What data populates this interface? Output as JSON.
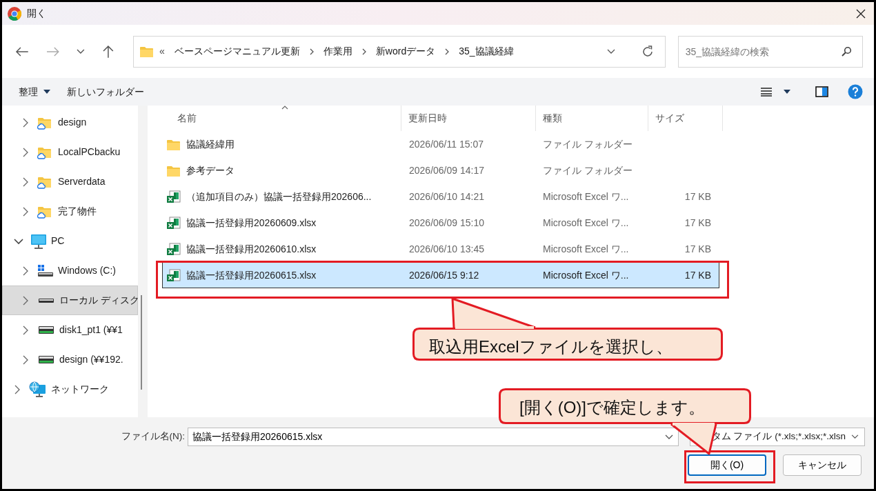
{
  "window": {
    "title": "開く"
  },
  "address": {
    "overflow": "«",
    "segments": [
      "ベースページマニュアル更新",
      "作業用",
      "新wordデータ",
      "35_協議経緯"
    ]
  },
  "search": {
    "placeholder": "35_協議経緯の検索"
  },
  "toolbar": {
    "organize": "整理",
    "new_folder": "新しいフォルダー"
  },
  "sidebar": {
    "items": [
      {
        "kind": "cloud-folder",
        "label": "design",
        "expanded": false,
        "selected": false
      },
      {
        "kind": "cloud-folder",
        "label": "LocalPCbacku",
        "expanded": false,
        "selected": false
      },
      {
        "kind": "cloud-folder",
        "label": "Serverdata",
        "expanded": false,
        "selected": false
      },
      {
        "kind": "cloud-folder",
        "label": "完了物件",
        "expanded": false,
        "selected": false
      },
      {
        "kind": "pc",
        "label": "PC",
        "expanded": true,
        "selected": false,
        "children": [
          {
            "kind": "windows-drive",
            "label": "Windows (C:)",
            "expanded": false,
            "selected": false
          },
          {
            "kind": "drive",
            "label": "ローカル ディスク",
            "expanded": false,
            "selected": true
          },
          {
            "kind": "network-drive",
            "label": "disk1_pt1 (¥¥1",
            "expanded": false,
            "selected": false
          },
          {
            "kind": "network-drive",
            "label": "design (¥¥192.",
            "expanded": false,
            "selected": false
          }
        ]
      },
      {
        "kind": "network",
        "label": "ネットワーク",
        "expanded": false,
        "selected": false
      }
    ]
  },
  "table": {
    "columns": [
      {
        "label": "名前",
        "sorted": true
      },
      {
        "label": "更新日時",
        "sorted": false
      },
      {
        "label": "種類",
        "sorted": false
      },
      {
        "label": "サイズ",
        "sorted": false
      }
    ],
    "rows": [
      {
        "kind": "folder",
        "name": "協議経緯用",
        "date": "2026/06/11 15:07",
        "type": "ファイル フォルダー",
        "selected": false
      },
      {
        "kind": "folder",
        "name": "参考データ",
        "date": "2026/06/09 14:17",
        "type": "ファイル フォルダー",
        "selected": false
      },
      {
        "kind": "excel",
        "name": "（追加項目のみ）協議一括登録用202606...",
        "date": "2026/06/10 14:21",
        "type": "Microsoft Excel ワ...",
        "size": "17 KB",
        "selected": false
      },
      {
        "kind": "excel",
        "name": "協議一括登録用20260609.xlsx",
        "date": "2026/06/09 15:10",
        "type": "Microsoft Excel ワ...",
        "size": "17 KB",
        "selected": false
      },
      {
        "kind": "excel",
        "name": "協議一括登録用20260610.xlsx",
        "date": "2026/06/10 13:45",
        "type": "Microsoft Excel ワ...",
        "size": "17 KB",
        "selected": false
      },
      {
        "kind": "excel",
        "name": "協議一括登録用20260615.xlsx",
        "date": "2026/06/15 9:12",
        "type": "Microsoft Excel ワ...",
        "size": "17 KB",
        "selected": true
      }
    ]
  },
  "footer": {
    "filename_label": "ファイル名(N):",
    "filename": "協議一括登録用20260615.xlsx",
    "filter": "タム ファイル (*.xls;*.xlsx;*.xlsn",
    "open_button": "開く(O)",
    "cancel_button": "キャンセル"
  },
  "callouts": [
    {
      "text": "取込用Excelファイルを選択し、"
    },
    {
      "text": "[開く(O)]で確定します。"
    }
  ]
}
